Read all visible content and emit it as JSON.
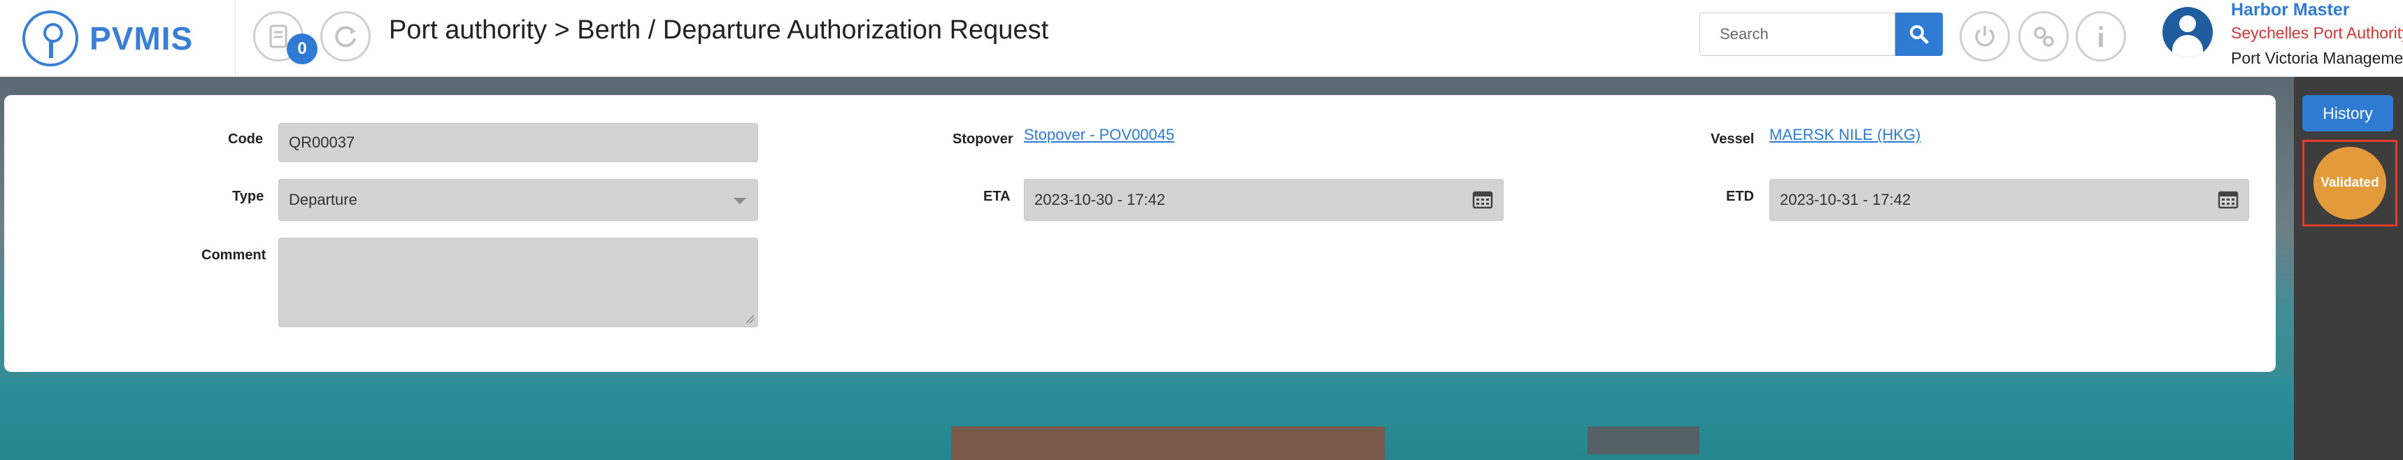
{
  "app": {
    "logo_text": "PVMIS"
  },
  "header": {
    "notification_count": "0",
    "breadcrumb": "Port authority > Berth / Departure Authorization Request",
    "search": {
      "placeholder": "Search",
      "value": ""
    }
  },
  "user": {
    "name": "Harbor Master",
    "organization": "Seychelles Port Authority",
    "port": "Port Victoria Management"
  },
  "form": {
    "code": {
      "label": "Code",
      "value": "QR00037"
    },
    "type": {
      "label": "Type",
      "value": "Departure"
    },
    "comment": {
      "label": "Comment",
      "value": ""
    },
    "stopover": {
      "label": "Stopover",
      "value": "Stopover - POV00045"
    },
    "eta": {
      "label": "ETA",
      "value": "2023-10-30 - 17:42"
    },
    "vessel": {
      "label": "Vessel",
      "value": "MAERSK NILE (HKG)"
    },
    "etd": {
      "label": "ETD",
      "value": "2023-10-31 - 17:42"
    }
  },
  "side": {
    "history_label": "History",
    "status_label": "Validated"
  },
  "colors": {
    "primary": "#2f7ad2",
    "status": "#e39a3b",
    "highlight": "#e53b2c",
    "org_text": "#d03535"
  }
}
